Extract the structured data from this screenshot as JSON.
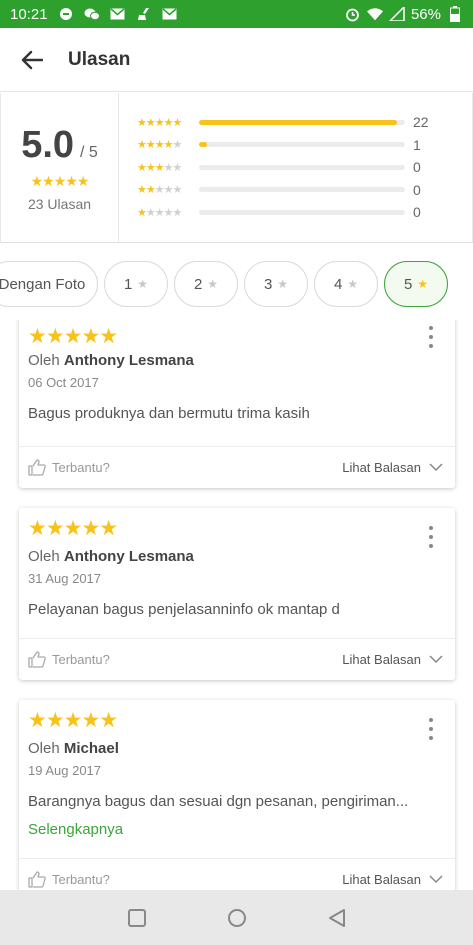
{
  "status": {
    "time": "10:21",
    "battery": "56%",
    "left_icons": [
      "chat-bubble-icon",
      "wechat-icon",
      "mail-icon",
      "broom-icon",
      "mail-icon"
    ],
    "right_icons": [
      "alarm-icon",
      "wifi-icon",
      "signal-icon",
      "battery-icon"
    ]
  },
  "app": {
    "title": "Ulasan"
  },
  "summary": {
    "average": "5.0",
    "out_of": "/ 5",
    "count_label": "23 Ulasan",
    "distribution": [
      {
        "stars": 5,
        "count": "22",
        "fraction": 0.96
      },
      {
        "stars": 4,
        "count": "1",
        "fraction": 0.04
      },
      {
        "stars": 3,
        "count": "0",
        "fraction": 0
      },
      {
        "stars": 2,
        "count": "0",
        "fraction": 0
      },
      {
        "stars": 1,
        "count": "0",
        "fraction": 0
      }
    ]
  },
  "filters": {
    "photo": "Dengan Foto",
    "ratings": [
      "1",
      "2",
      "3",
      "4",
      "5"
    ],
    "active": "5"
  },
  "reviews": [
    {
      "stars": 5,
      "by_prefix": "Oleh",
      "author": "Anthony Lesmana",
      "date": "06 Oct 2017",
      "text": "Bagus produknya dan bermutu trima kasih",
      "more": "",
      "helpful": "Terbantu?",
      "replies": "Lihat Balasan"
    },
    {
      "stars": 5,
      "by_prefix": "Oleh",
      "author": "Anthony Lesmana",
      "date": "31 Aug 2017",
      "text": "Pelayanan bagus penjelasanninfo ok mantap d",
      "more": "",
      "helpful": "Terbantu?",
      "replies": "Lihat Balasan"
    },
    {
      "stars": 5,
      "by_prefix": "Oleh",
      "author": "Michael",
      "date": "19 Aug 2017",
      "text": "Barangnya bagus dan sesuai dgn pesanan, pengiriman...",
      "more": "Selengkapnya",
      "helpful": "Terbantu?",
      "replies": "Lihat Balasan"
    }
  ],
  "colors": {
    "brand": "#2ea02e",
    "star": "#f8c21c",
    "link": "#3aa63a"
  }
}
